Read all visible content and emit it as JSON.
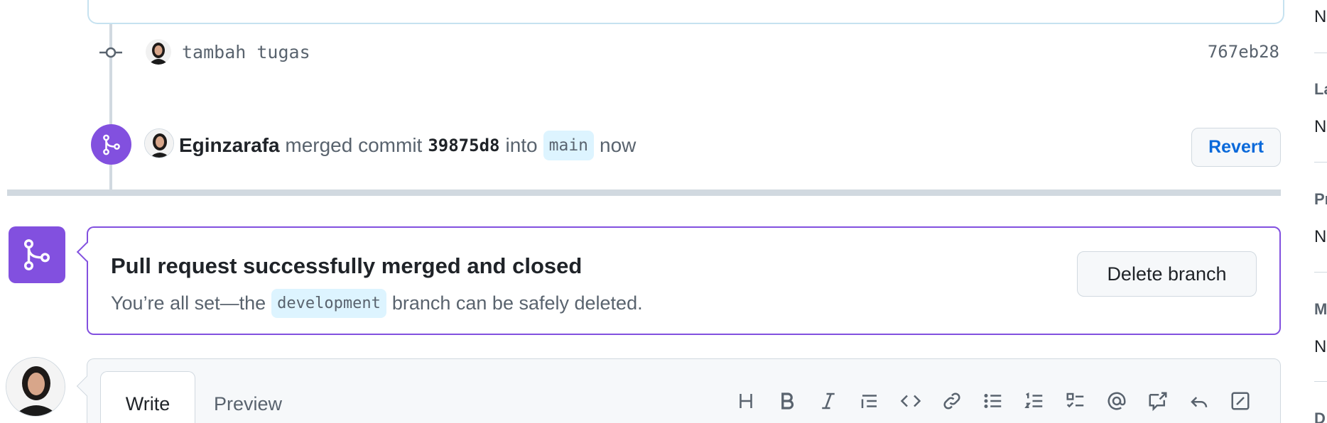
{
  "timeline": {
    "commit": {
      "message": "tambah tugas",
      "sha": "767eb28"
    },
    "merge_event": {
      "user": "Eginzarafa",
      "action": "merged commit",
      "commit_sha": "39875d8",
      "into": "into",
      "target_branch": "main",
      "time": "now",
      "revert_label": "Revert"
    }
  },
  "merged_box": {
    "title": "Pull request successfully merged and closed",
    "subtitle_prefix": "You’re all set—the",
    "branch": "development",
    "subtitle_suffix": "branch can be safely deleted.",
    "delete_label": "Delete branch"
  },
  "composer": {
    "tabs": {
      "write": "Write",
      "preview": "Preview"
    },
    "toolbar_icons": [
      "heading-icon",
      "bold-icon",
      "italic-icon",
      "quote-icon",
      "code-icon",
      "link-icon",
      "unordered-list-icon",
      "ordered-list-icon",
      "task-list-icon",
      "mention-icon",
      "reference-icon",
      "reply-icon",
      "edit-icon"
    ]
  },
  "sidebar": {
    "items": [
      {
        "head": "",
        "value": "N"
      },
      {
        "head": "La",
        "value": "N"
      },
      {
        "head": "Pr",
        "value": "N"
      },
      {
        "head": "M",
        "value": "N"
      },
      {
        "head": "D",
        "value": ""
      }
    ]
  },
  "colors": {
    "merged_purple": "#8250df",
    "link_blue": "#0969da",
    "branch_bg": "#ddf4ff",
    "border": "#d1d9e0"
  }
}
